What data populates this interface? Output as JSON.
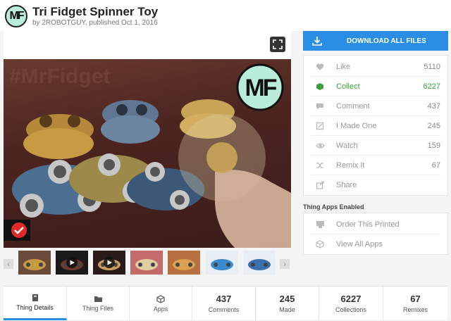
{
  "header": {
    "logo_text": "MF",
    "title": "Tri Fidget Spinner Toy",
    "byline": "by 2ROBOTGUY, published Oct 1, 2016"
  },
  "media": {
    "watermark": "#MrFidget",
    "badge_text": "MF",
    "expand_icon": "expand-icon"
  },
  "thumbnails": [
    {
      "name": "thumb-1",
      "video": false
    },
    {
      "name": "thumb-2",
      "video": true
    },
    {
      "name": "thumb-3",
      "video": true
    },
    {
      "name": "thumb-4",
      "video": false
    },
    {
      "name": "thumb-5",
      "video": false
    },
    {
      "name": "thumb-6",
      "video": false
    },
    {
      "name": "thumb-7",
      "video": false
    }
  ],
  "sidebar": {
    "download_label": "DOWNLOAD ALL FILES",
    "stats": [
      {
        "label": "Like",
        "count": "5110",
        "icon": "heart-icon"
      },
      {
        "label": "Collect",
        "count": "6227",
        "icon": "collect-icon"
      },
      {
        "label": "Comment",
        "count": "437",
        "icon": "comment-icon"
      },
      {
        "label": "I Made One",
        "count": "245",
        "icon": "made-icon"
      },
      {
        "label": "Watch",
        "count": "159",
        "icon": "eye-icon"
      },
      {
        "label": "Remix It",
        "count": "67",
        "icon": "remix-icon"
      },
      {
        "label": "Share",
        "count": "",
        "icon": "share-icon"
      }
    ],
    "apps_title": "Thing Apps Enabled",
    "apps": [
      {
        "label": "Order This Printed",
        "icon": "printer-icon"
      },
      {
        "label": "View All Apps",
        "icon": "cube-icon"
      }
    ]
  },
  "tabs": [
    {
      "label": "Thing Details",
      "count": "",
      "icon": "book-icon"
    },
    {
      "label": "Thing Files",
      "count": "",
      "icon": "folder-icon"
    },
    {
      "label": "Apps",
      "count": "",
      "icon": "cube-icon"
    },
    {
      "label": "Comments",
      "count": "437",
      "icon": ""
    },
    {
      "label": "Made",
      "count": "245",
      "icon": ""
    },
    {
      "label": "Collections",
      "count": "6227",
      "icon": ""
    },
    {
      "label": "Remixes",
      "count": "67",
      "icon": ""
    }
  ],
  "colors": {
    "accent": "#2a8ee4",
    "collect": "#3e9e3e"
  }
}
